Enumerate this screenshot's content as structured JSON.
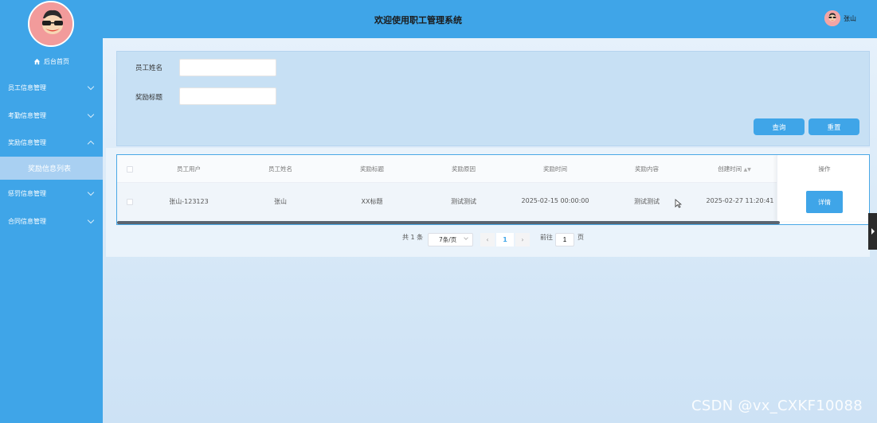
{
  "app": {
    "title": "欢迎使用职工管理系统"
  },
  "user": {
    "name": "张山"
  },
  "sidebar": {
    "home": "后台首页",
    "items": [
      {
        "label": "员工信息管理",
        "expanded": false
      },
      {
        "label": "考勤信息管理",
        "expanded": false
      },
      {
        "label": "奖励信息管理",
        "expanded": true
      },
      {
        "label": "惩罚信息管理",
        "expanded": false
      },
      {
        "label": "合同信息管理",
        "expanded": false
      }
    ],
    "active_sub": "奖励信息列表"
  },
  "search": {
    "name_label": "员工姓名",
    "name_value": "",
    "title_label": "奖励标题",
    "title_value": "",
    "query_label": "查询",
    "reset_label": "重置"
  },
  "table": {
    "columns": [
      "员工用户",
      "员工姓名",
      "奖励标题",
      "奖励原因",
      "奖励时间",
      "奖励内容",
      "创建时间",
      "操作"
    ],
    "rows": [
      {
        "user": "张山-123123",
        "name": "张山",
        "title": "XX标题",
        "reason": "测试测试",
        "time": "2025-02-15 00:00:00",
        "content": "测试测试",
        "created": "2025-02-27 11:20:41",
        "action": "详情"
      }
    ]
  },
  "pagination": {
    "total": "共 1 条",
    "page_size": "7条/页",
    "current_page": "1",
    "goto_label": "前往",
    "goto_value": "1",
    "page_unit": "页"
  },
  "watermark": "CSDN @vx_CXKF10088",
  "colors": {
    "primary": "#3fa5e8",
    "sub_active": "#a9d0f2",
    "avatar": "#f29b9b"
  }
}
